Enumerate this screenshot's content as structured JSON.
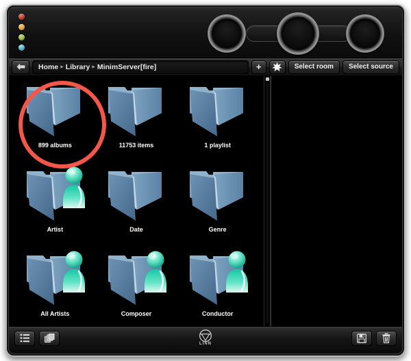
{
  "window": {
    "status_lights": [
      {
        "name": "light-red",
        "color": "#c0392b"
      },
      {
        "name": "light-orange",
        "color": "#d69226"
      },
      {
        "name": "light-green",
        "color": "#86a52c"
      },
      {
        "name": "light-cyan",
        "color": "#3aa0ba"
      }
    ]
  },
  "top_panel": {
    "knobs": [
      {
        "name": "volume-knob-left"
      },
      {
        "name": "volume-knob-center"
      },
      {
        "name": "volume-knob-right"
      }
    ],
    "pills": [
      {
        "name": "transport-pill-left"
      },
      {
        "name": "transport-pill-right"
      }
    ]
  },
  "toolbar": {
    "back_icon": "back-arrow-icon",
    "breadcrumb": [
      {
        "label": "Home"
      },
      {
        "label": "Library"
      },
      {
        "label": "MinimServer[fire]"
      }
    ],
    "breadcrumb_separator": "▸",
    "add_label": "+",
    "favourite_icon": "star-icon",
    "select_room_label": "Select room",
    "select_source_label": "Select source"
  },
  "browse": {
    "folders": [
      {
        "label": "899 albums",
        "icon": "folder-icon",
        "person": false
      },
      {
        "label": "11753 items",
        "icon": "folder-icon",
        "person": false
      },
      {
        "label": "1 playlist",
        "icon": "folder-icon",
        "person": false
      },
      {
        "label": "Artist",
        "icon": "folder-person-icon",
        "person": true
      },
      {
        "label": "Date",
        "icon": "folder-icon",
        "person": false
      },
      {
        "label": "Genre",
        "icon": "folder-icon",
        "person": false
      },
      {
        "label": "All Artists",
        "icon": "folder-person-icon",
        "person": true
      },
      {
        "label": "Composer",
        "icon": "folder-person-icon",
        "person": true
      },
      {
        "label": "Conductor",
        "icon": "folder-person-icon",
        "person": true
      }
    ]
  },
  "bottom_bar": {
    "list_view_icon": "list-view-icon",
    "stack_view_icon": "stack-view-icon",
    "save_icon": "floppy-save-icon",
    "delete_icon": "trash-icon",
    "brand_icon": "linn-logo-icon",
    "brand_text": "LINN"
  },
  "annotation": {
    "shape": "circle",
    "color": "#f4564a",
    "target_label": "899 albums"
  }
}
